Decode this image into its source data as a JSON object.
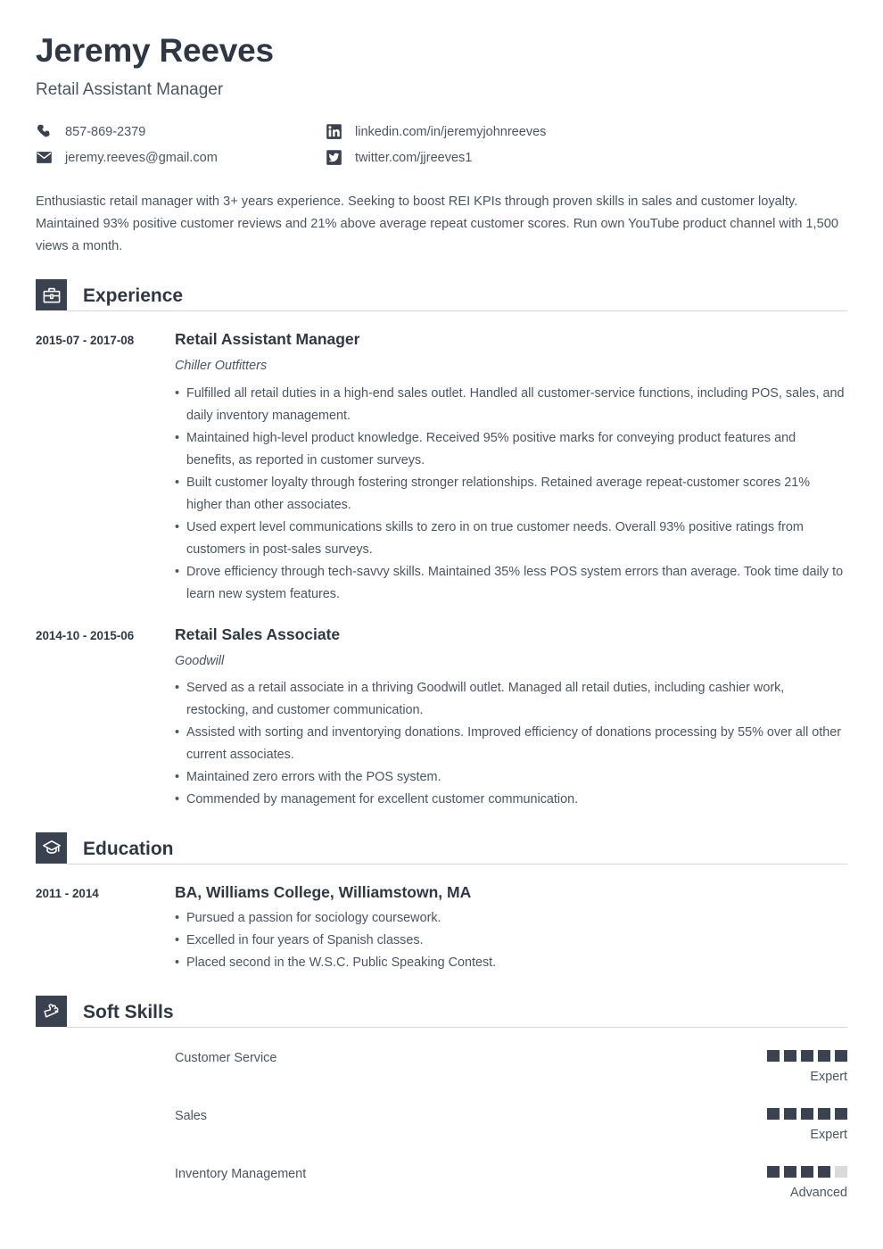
{
  "theme": {
    "dark": "#3a4250",
    "heading": "#2f3744",
    "body": "#4b5563",
    "rule": "#d6d8db",
    "dot_off": "#d8dade"
  },
  "header": {
    "name": "Jeremy Reeves",
    "job_title": "Retail Assistant Manager"
  },
  "contacts": [
    {
      "icon": "phone-icon",
      "text": "857-869-2379"
    },
    {
      "icon": "linkedin-icon",
      "text": "linkedin.com/in/jeremyjohnreeves"
    },
    {
      "icon": "email-icon",
      "text": "jeremy.reeves@gmail.com"
    },
    {
      "icon": "twitter-icon",
      "text": "twitter.com/jjreeves1"
    }
  ],
  "summary": "Enthusiastic retail manager with 3+ years experience. Seeking to boost REI KPIs through proven skills in sales and customer loyalty. Maintained 93% positive customer reviews and 21% above average repeat customer scores. Run own YouTube product channel with 1,500 views a month.",
  "sections": {
    "experience": {
      "title": "Experience",
      "icon": "briefcase-icon",
      "entries": [
        {
          "dates": "2015-07 - 2017-08",
          "role": "Retail Assistant Manager",
          "org": "Chiller Outfitters",
          "bullets": [
            "Fulfilled all retail duties in a high-end sales outlet. Handled all customer-service functions, including POS, sales, and daily inventory management.",
            "Maintained high-level product knowledge. Received 95% positive marks for conveying product features and benefits, as reported in customer surveys.",
            "Built customer loyalty through fostering stronger relationships. Retained average repeat-customer scores 21% higher than other associates.",
            "Used expert level communications skills to zero in on true customer needs. Overall 93% positive ratings from customers in post-sales surveys.",
            "Drove efficiency through tech-savvy skills. Maintained 35% less POS system errors than average. Took time daily to learn new system features."
          ]
        },
        {
          "dates": "2014-10 - 2015-06",
          "role": "Retail Sales Associate",
          "org": "Goodwill",
          "bullets": [
            "Served as a retail associate in a thriving Goodwill outlet. Managed all retail duties, including cashier work, restocking, and customer communication.",
            "Assisted with sorting and inventorying donations. Improved efficiency of donations processing by 55% over all other current associates.",
            "Maintained zero errors with the POS system.",
            "Commended by management for excellent customer communication."
          ]
        }
      ]
    },
    "education": {
      "title": "Education",
      "icon": "graduation-cap-icon",
      "entries": [
        {
          "dates": "2011 - 2014",
          "degree": "BA, Williams College, Williamstown, MA",
          "bullets": [
            "Pursued a passion for sociology coursework.",
            "Excelled in four years of Spanish classes.",
            "Placed second in the W.S.C. Public Speaking Contest."
          ]
        }
      ]
    },
    "soft_skills": {
      "title": "Soft Skills",
      "icon": "puzzle-piece-icon",
      "max_rating": 5,
      "items": [
        {
          "name": "Customer Service",
          "rating": 5,
          "level": "Expert"
        },
        {
          "name": "Sales",
          "rating": 5,
          "level": "Expert"
        },
        {
          "name": "Inventory Management",
          "rating": 4,
          "level": "Advanced"
        }
      ]
    }
  }
}
